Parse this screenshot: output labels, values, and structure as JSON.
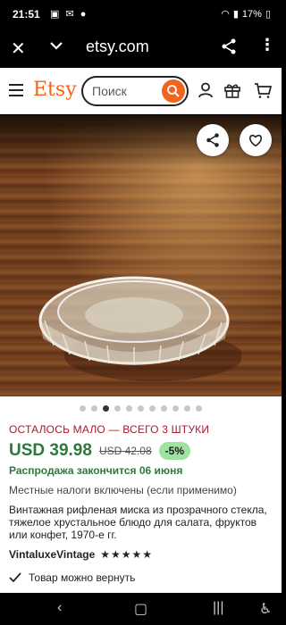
{
  "status_bar": {
    "time": "21:51",
    "battery": "17%"
  },
  "browser": {
    "url": "etsy.com"
  },
  "header": {
    "logo": "Etsy",
    "search_placeholder": "Поиск"
  },
  "carousel": {
    "total": 11,
    "active_index": 2
  },
  "product": {
    "low_stock": "ОСТАЛОСЬ МАЛО — ВСЕГО 3 ШТУКИ",
    "price": "USD 39.98",
    "old_price": "USD 42.08",
    "discount": "-5%",
    "sale_ends": "Распродажа закончится 06 июня",
    "taxes": "Местные налоги включены (если применимо)",
    "title": "Винтажная рифленая миска из прозрачного стекла, тяжелое хрустальное блюдо для салата, фруктов или конфет, 1970-е гг.",
    "shop_name": "VintaluxeVintage",
    "rating_stars": 5,
    "stars_text": "★★★★★",
    "returns": "Товар можно вернуть"
  },
  "colors": {
    "brand": "#f1641e",
    "price_green": "#2b7a3b",
    "low_stock_red": "#a61a2e"
  }
}
